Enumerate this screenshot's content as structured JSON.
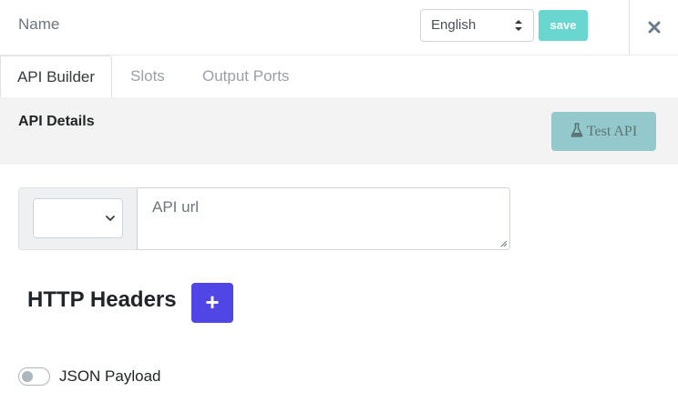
{
  "header": {
    "name_label": "Name",
    "language": {
      "selected": "English"
    },
    "save_label": "save"
  },
  "tabs": [
    {
      "label": "API Builder",
      "active": true
    },
    {
      "label": "Slots",
      "active": false
    },
    {
      "label": "Output Ports",
      "active": false
    }
  ],
  "details": {
    "title": "API Details",
    "test_api_label": "Test API"
  },
  "request": {
    "method_selected": "",
    "url_placeholder": "API url",
    "url_value": ""
  },
  "http_headers": {
    "title": "HTTP Headers",
    "add_label": "+"
  },
  "json_payload": {
    "label": "JSON Payload",
    "enabled": false
  },
  "colors": {
    "save_button": "#6ad6d0",
    "test_api_button": "#93c9cc",
    "add_header_button": "#5046e5",
    "details_background": "#f3f3f3"
  },
  "icons": {
    "close": "close-icon",
    "flask": "flask-icon",
    "plus": "plus-icon",
    "chevron": "chevron-down-icon",
    "select_arrows": "sort-arrows-icon"
  }
}
